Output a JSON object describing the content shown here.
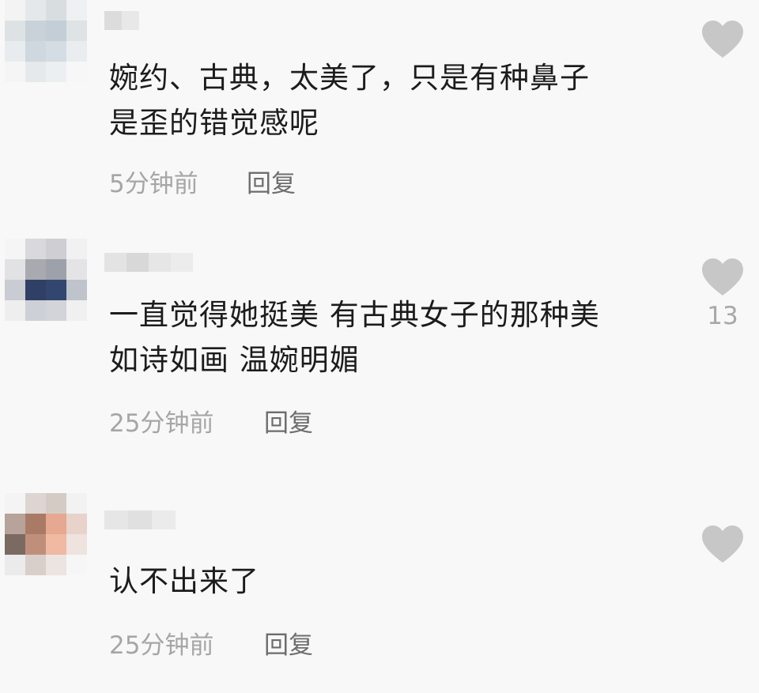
{
  "comments": [
    {
      "text_lines": [
        "婉约、古典，太美了，只是有种鼻子",
        "是歪的错觉感呢"
      ],
      "time": "5分钟前",
      "reply_label": "回复",
      "like_count": ""
    },
    {
      "text_lines": [
        "一直觉得她挺美 有古典女子的那种美",
        "如诗如画 温婉明媚"
      ],
      "time": "25分钟前",
      "reply_label": "回复",
      "like_count": "13"
    },
    {
      "text_lines": [
        "认不出来了"
      ],
      "time": "25分钟前",
      "reply_label": "回复",
      "like_count": ""
    }
  ],
  "icons": {
    "like": "heart-icon",
    "avatar": "pixelated-avatar"
  },
  "colors": {
    "background": "#f8f8f8",
    "text": "#1c1c1c",
    "meta": "#a6a6a6",
    "reply": "#6d6d6d",
    "heart": "#c7c7c7"
  }
}
